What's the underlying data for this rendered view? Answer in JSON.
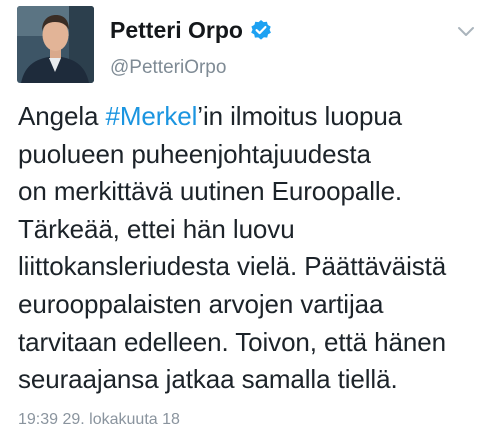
{
  "author": {
    "display_name": "Petteri Orpo",
    "handle": "@PetteriOrpo"
  },
  "icons": {
    "verified": "verified-badge-icon",
    "menu": "chevron-down-icon"
  },
  "colors": {
    "hashtag": "#1b95e0",
    "verified": "#1da1f2",
    "secondary_text": "#8a949e"
  },
  "tweet": {
    "line1": {
      "before": "Angela ",
      "hashtag": "#Merkel",
      "after": "’in ilmoitus luopua"
    },
    "lines": [
      "puolueen puheenjohtajuudesta",
      "on merkittävä uutinen Euroopalle.",
      "Tärkeää, ettei hän luovu",
      "liittokansleriudesta vielä. Päättäväistä",
      "eurooppalaisten arvojen vartijaa",
      "tarvitaan edelleen. Toivon, että hänen",
      "seuraajansa jatkaa samalla tiellä."
    ],
    "timestamp": "19:39 29. lokakuuta 18"
  }
}
